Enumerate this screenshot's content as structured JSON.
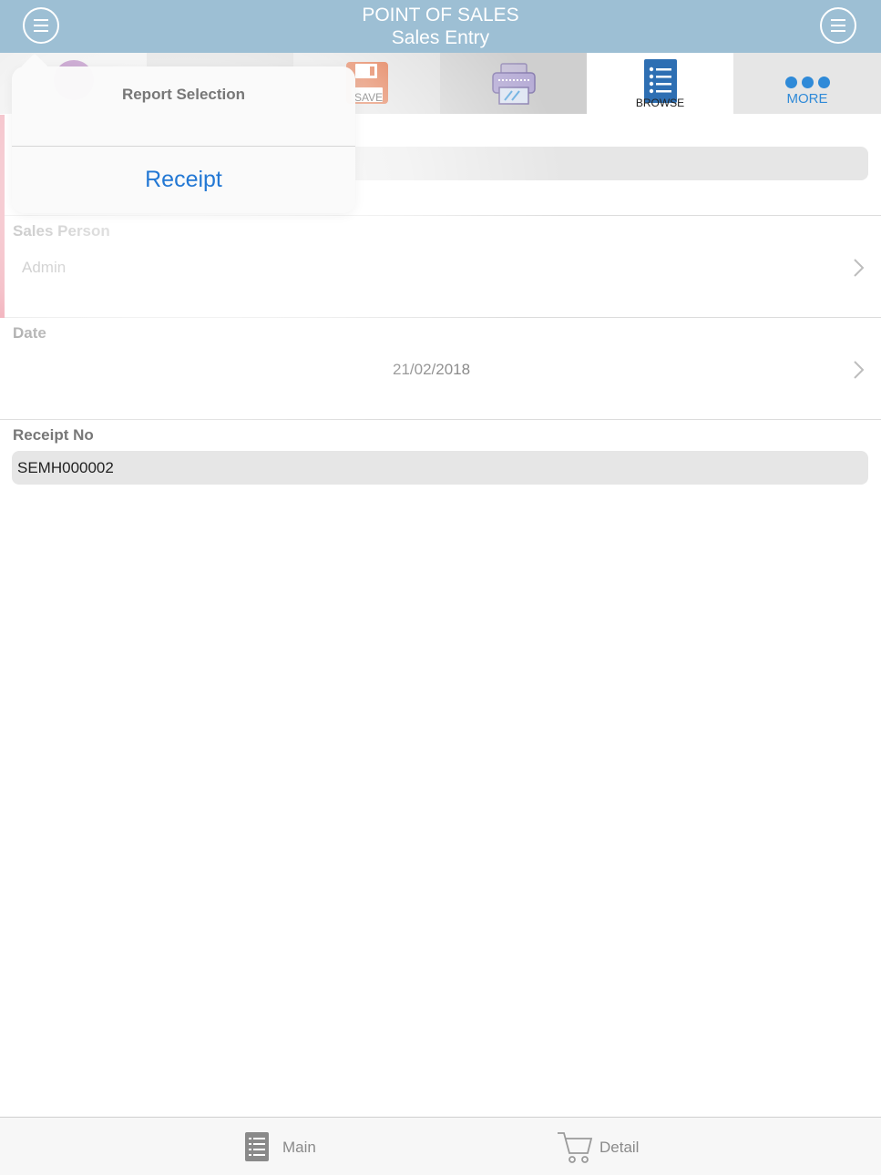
{
  "header": {
    "title": "POINT OF SALES",
    "subtitle": "Sales Entry",
    "left_button_icon": "menu-circle-icon",
    "right_button_icon": "menu-circle-icon"
  },
  "toolbar": {
    "save_label": "SAVE",
    "browse_label": "BROWSE",
    "more_label": "MORE"
  },
  "popover": {
    "title": "Report Selection",
    "items": [
      "Receipt"
    ]
  },
  "form": {
    "sales_person": {
      "label": "Sales Person",
      "value": "Admin"
    },
    "date": {
      "label": "Date",
      "value": "21/02/2018"
    },
    "receipt_no": {
      "label": "Receipt No",
      "value": "SEMH000002"
    }
  },
  "tabs": [
    {
      "label": "Main",
      "icon": "list-icon"
    },
    {
      "label": "Detail",
      "icon": "cart-icon"
    }
  ],
  "colors": {
    "header_bg": "#9dbfd4",
    "accent": "#2f8ad8",
    "required_marker": "#e8788a",
    "save_orange": "#d9531e"
  }
}
